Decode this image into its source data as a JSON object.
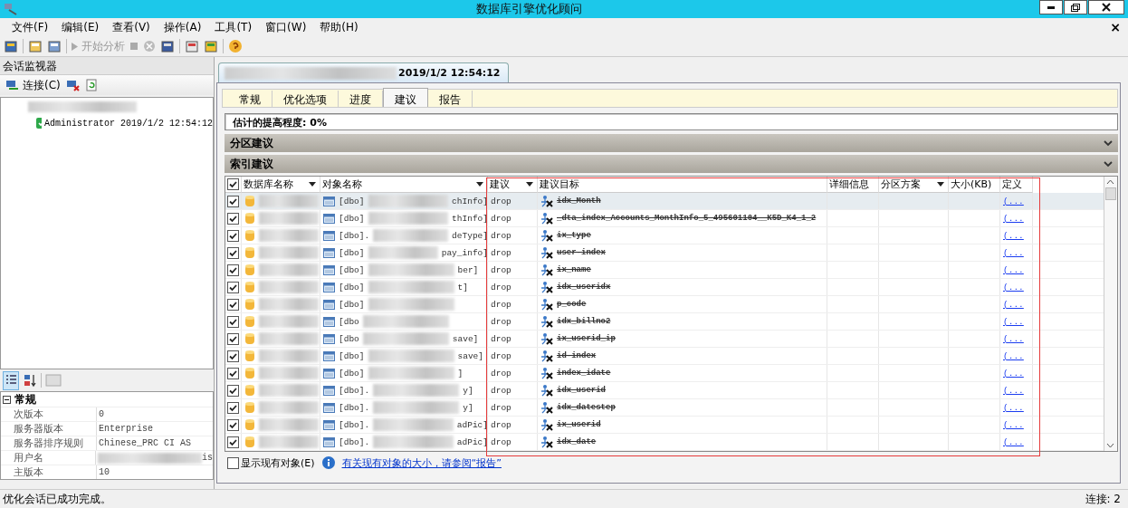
{
  "window": {
    "title": "数据库引擎优化顾问"
  },
  "menu": [
    {
      "label": "文件(F)"
    },
    {
      "label": "编辑(E)"
    },
    {
      "label": "查看(V)"
    },
    {
      "label": "操作(A)"
    },
    {
      "label": "工具(T)"
    },
    {
      "label": "窗口(W)"
    },
    {
      "label": "帮助(H)"
    }
  ],
  "menu_close": "×",
  "toolbar": {
    "start_analysis": {
      "label": "开始分析",
      "disabled": true
    }
  },
  "session_monitor": {
    "title": "会话监视器",
    "connect_label": "连接(C)",
    "sessions": [
      {
        "label": "Administrator 2019/1/2 12:54:12"
      }
    ],
    "properties": {
      "category": "常规",
      "expanded": true,
      "rows": [
        {
          "name": "次版本",
          "value": "0"
        },
        {
          "name": "服务器版本",
          "value": "Enterprise"
        },
        {
          "name": "服务器排序规则",
          "value": "Chinese_PRC CI AS"
        },
        {
          "name": "用户名",
          "value": "is",
          "blurred": true
        },
        {
          "name": "主版本",
          "value": "10"
        }
      ]
    }
  },
  "document_tab": {
    "label": "2019/1/2 12:54:12"
  },
  "tabs": [
    {
      "label": "常规",
      "selected": false
    },
    {
      "label": "优化选项",
      "selected": false
    },
    {
      "label": "进度",
      "selected": false
    },
    {
      "label": "建议",
      "selected": true
    },
    {
      "label": "报告",
      "selected": false
    }
  ],
  "improvement": "估计的提高程度: 0%",
  "partition_section": {
    "title": "分区建议"
  },
  "index_section": {
    "title": "索引建议",
    "select_all_checked": true,
    "columns": [
      {
        "label": "数据库名称",
        "filter": true
      },
      {
        "label": "对象名称",
        "filter": true
      },
      {
        "label": "建议",
        "filter": true
      },
      {
        "label": "建议目标",
        "filter": false
      },
      {
        "label": "详细信息",
        "filter": false
      },
      {
        "label": "分区方案",
        "filter": true
      },
      {
        "label": "大小(KB)",
        "filter": false
      },
      {
        "label": "定义",
        "filter": false
      }
    ],
    "rows": [
      {
        "checked": true,
        "selected": true,
        "object": "[dbo]",
        "object_end": "chInfo]",
        "action": "drop",
        "target": "idx_Month",
        "definition": "(..."
      },
      {
        "checked": true,
        "selected": false,
        "object": "[dbo]",
        "object_end": "thInfo]",
        "action": "drop",
        "target": "_dta_index_Accounts_MonthInfo_5_495601104__K5D_K4_1_2",
        "definition": "(..."
      },
      {
        "checked": true,
        "selected": false,
        "object": "[dbo].",
        "object_end": "deType]",
        "action": "drop",
        "target": "ix_type",
        "definition": "(..."
      },
      {
        "checked": true,
        "selected": false,
        "object": "[dbo]",
        "object_end": "pay_info]",
        "action": "drop",
        "target": "user-index",
        "definition": "(..."
      },
      {
        "checked": true,
        "selected": false,
        "object": "[dbo]",
        "object_end": "ber]",
        "action": "drop",
        "target": "ix_name",
        "definition": "(..."
      },
      {
        "checked": true,
        "selected": false,
        "object": "[dbo]",
        "object_end": "t]",
        "action": "drop",
        "target": "idx_useridx",
        "definition": "(..."
      },
      {
        "checked": true,
        "selected": false,
        "object": "[dbo]",
        "object_end": "",
        "action": "drop",
        "target": "p_code",
        "definition": "(..."
      },
      {
        "checked": true,
        "selected": false,
        "object": "[dbo",
        "object_end": "",
        "action": "drop",
        "target": "idx_billno2",
        "definition": "(..."
      },
      {
        "checked": true,
        "selected": false,
        "object": "[dbo",
        "object_end": "save]",
        "action": "drop",
        "target": "ix_userid_ip",
        "definition": "(..."
      },
      {
        "checked": true,
        "selected": false,
        "object": "[dbo]",
        "object_end": "save]",
        "action": "drop",
        "target": "id-index",
        "definition": "(..."
      },
      {
        "checked": true,
        "selected": false,
        "object": "[dbo]",
        "object_end": "]",
        "action": "drop",
        "target": "index_idate",
        "definition": "(..."
      },
      {
        "checked": true,
        "selected": false,
        "object": "[dbo].",
        "object_end": "y]",
        "action": "drop",
        "target": "idx_userid",
        "definition": "(..."
      },
      {
        "checked": true,
        "selected": false,
        "object": "[dbo].",
        "object_end": "y]",
        "action": "drop",
        "target": "idx_datestep",
        "definition": "(..."
      },
      {
        "checked": true,
        "selected": false,
        "object": "[dbo].",
        "object_end": "adPic]",
        "action": "drop",
        "target": "ix_userid",
        "definition": "(..."
      },
      {
        "checked": true,
        "selected": false,
        "object": "[dbo].",
        "object_end": "adPic]",
        "action": "drop",
        "target": "idx_date",
        "definition": "(..."
      }
    ]
  },
  "show_existing": {
    "label": "显示现有对象(E)",
    "checked": false
  },
  "info_link": "有关现有对象的大小，请参阅“报告”",
  "status_bar": {
    "message": "优化会话已成功完成。",
    "connections": "连接: 2"
  }
}
